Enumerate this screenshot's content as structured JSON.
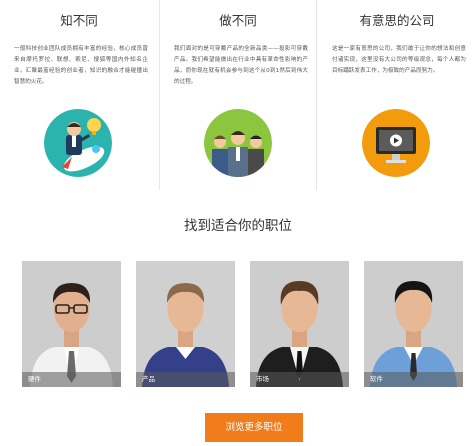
{
  "features": [
    {
      "title": "知不同",
      "text": "一般科技创业团队成员拥有丰富的经验，核心成员曾来自摩托罗拉、联想、索尼、搜狐等国内外知名企业，汇聚最富经验的创业者，知识的融合才能碰撞出智慧的火花。",
      "icon": "rocket-businessman-icon",
      "circle_color": "#2bb3ad"
    },
    {
      "title": "做不同",
      "text": "我们面对的是可穿戴产品的全新品类——投影可穿戴产品。我们希望能做出在行业中具有革命性影响的产品，而你现在就有机会参与到这个从0到1然后到伟大的过程。",
      "icon": "team-group-icon",
      "circle_color": "#8cc63f"
    },
    {
      "title": "有意思的公司",
      "text": "这是一家有意思的公司，我们敢于让你的想法和创意付诸实现，这里没有大公司的等级观念，每个人都为目标踊跃发表工作，为极致的产品而努力。",
      "icon": "monitor-play-icon",
      "circle_color": "#f29b0d"
    }
  ],
  "jobs_title": "找到适合你的职位",
  "jobs": [
    {
      "label": "硬件",
      "avatar": "man-glasses-icon"
    },
    {
      "label": "产品",
      "avatar": "man-sweater-icon"
    },
    {
      "label": "市场",
      "avatar": "man-suit-icon"
    },
    {
      "label": "软件",
      "avatar": "man-shirt-icon"
    }
  ],
  "browse_button": "浏览更多职位"
}
